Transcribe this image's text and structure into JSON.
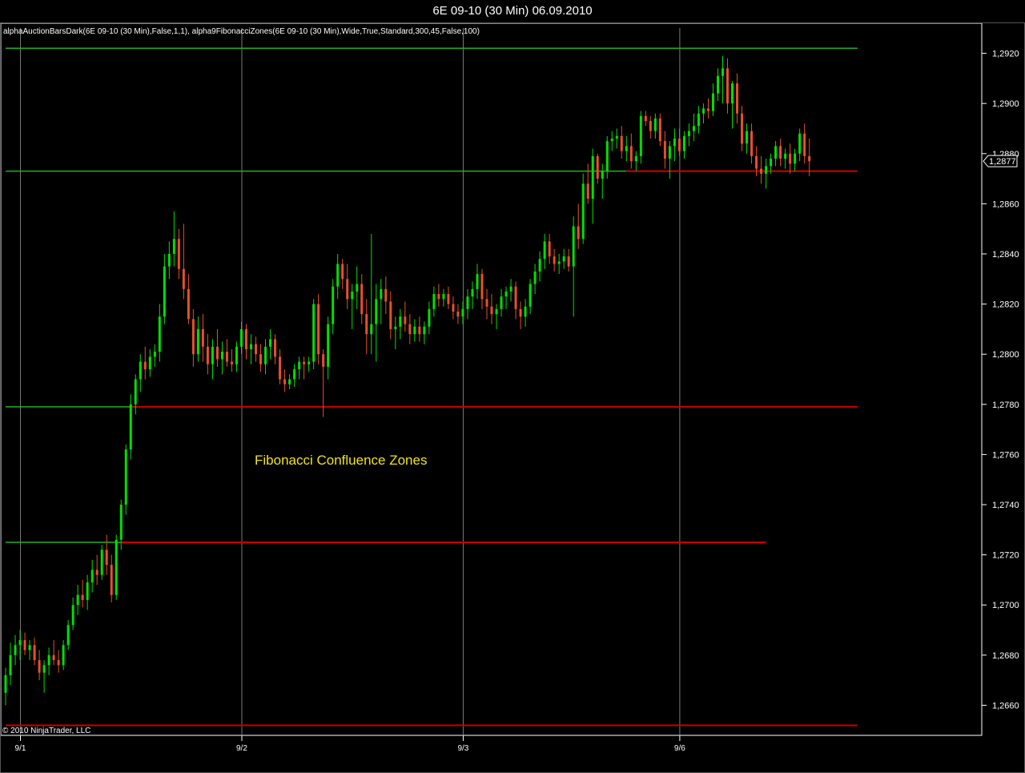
{
  "window": {
    "title": "6E 09-10 (30 Min)  06.09.2010"
  },
  "indicator_text": "alphaAuctionBarsDark(6E 09-10 (30 Min),False,1,1), alpha9FibonacciZones(6E 09-10 (30 Min),Wide,True,Standard,300,45,False,100)",
  "copyright": "© 2010 NinjaTrader, LLC",
  "colors": {
    "background": "#000000",
    "up_bar": "#00e000",
    "down_bar": "#e8502a",
    "zone_green": "#22b022",
    "zone_red": "#cc0000",
    "grid": "#7a7a7a",
    "annotation": "#f2e218"
  },
  "chart_data": {
    "type": "candlestick",
    "instrument": "6E 09-10",
    "timeframe": "30 Min",
    "ylim": [
      1.2648,
      1.2932
    ],
    "y_ticks": [
      "1,2660",
      "1,2680",
      "1,2700",
      "1,2720",
      "1,2740",
      "1,2760",
      "1,2780",
      "1,2800",
      "1,2820",
      "1,2840",
      "1,2860",
      "1,2880",
      "1,2900",
      "1,2920"
    ],
    "y_tick_values": [
      1.266,
      1.268,
      1.27,
      1.272,
      1.274,
      1.276,
      1.278,
      1.28,
      1.282,
      1.284,
      1.286,
      1.288,
      1.29,
      1.292
    ],
    "x_dates": [
      "9/1",
      "9/2",
      "9/3",
      "9/6"
    ],
    "x_date_bar_index": [
      3,
      49,
      95,
      140
    ],
    "last_price": "1,2877",
    "last_price_value": 1.2877,
    "zones": [
      {
        "level": 1.2922,
        "color": "green",
        "start_bar": 0,
        "end_bar": 177
      },
      {
        "level": 1.2873,
        "color": "green",
        "start_bar": 0,
        "end_bar": 129
      },
      {
        "level": 1.2873,
        "color": "red",
        "start_bar": 129,
        "end_bar": 177
      },
      {
        "level": 1.2779,
        "color": "green",
        "start_bar": 0,
        "end_bar": 26
      },
      {
        "level": 1.2779,
        "color": "red",
        "start_bar": 26,
        "end_bar": 177
      },
      {
        "level": 1.2725,
        "color": "green",
        "start_bar": 0,
        "end_bar": 24
      },
      {
        "level": 1.2725,
        "color": "red",
        "start_bar": 24,
        "end_bar": 158
      },
      {
        "level": 1.2652,
        "color": "red",
        "start_bar": 0,
        "end_bar": 177
      }
    ],
    "annotation": "Fibonacci Confluence Zones",
    "bars": [
      [
        1.2665,
        1.2675,
        1.266,
        1.2672
      ],
      [
        1.2672,
        1.2685,
        1.2668,
        1.268
      ],
      [
        1.268,
        1.2688,
        1.2676,
        1.2684
      ],
      [
        1.2684,
        1.269,
        1.2678,
        1.2686
      ],
      [
        1.2686,
        1.2689,
        1.268,
        1.2682
      ],
      [
        1.2682,
        1.2686,
        1.2678,
        1.2684
      ],
      [
        1.2684,
        1.2687,
        1.2676,
        1.2678
      ],
      [
        1.2678,
        1.2682,
        1.267,
        1.2673
      ],
      [
        1.2673,
        1.2678,
        1.2665,
        1.2676
      ],
      [
        1.2676,
        1.2683,
        1.2672,
        1.268
      ],
      [
        1.268,
        1.2686,
        1.2676,
        1.2678
      ],
      [
        1.2678,
        1.2682,
        1.2673,
        1.2676
      ],
      [
        1.2676,
        1.2686,
        1.2674,
        1.2684
      ],
      [
        1.2684,
        1.2694,
        1.2682,
        1.2692
      ],
      [
        1.2692,
        1.2703,
        1.269,
        1.27
      ],
      [
        1.27,
        1.2708,
        1.2696,
        1.2704
      ],
      [
        1.2704,
        1.271,
        1.2699,
        1.2702
      ],
      [
        1.2702,
        1.2712,
        1.2698,
        1.2709
      ],
      [
        1.2709,
        1.2718,
        1.2705,
        1.2714
      ],
      [
        1.2714,
        1.272,
        1.2708,
        1.2712
      ],
      [
        1.2712,
        1.2724,
        1.271,
        1.2722
      ],
      [
        1.2722,
        1.2728,
        1.2712,
        1.2716
      ],
      [
        1.2716,
        1.272,
        1.2701,
        1.2704
      ],
      [
        1.2704,
        1.2728,
        1.2702,
        1.2726
      ],
      [
        1.2726,
        1.2742,
        1.2722,
        1.274
      ],
      [
        1.274,
        1.2764,
        1.2736,
        1.2762
      ],
      [
        1.2762,
        1.2784,
        1.2758,
        1.278
      ],
      [
        1.278,
        1.2792,
        1.2776,
        1.279
      ],
      [
        1.279,
        1.28,
        1.2785,
        1.2797
      ],
      [
        1.2797,
        1.2803,
        1.279,
        1.2794
      ],
      [
        1.2794,
        1.2802,
        1.2791,
        1.2799
      ],
      [
        1.2799,
        1.2804,
        1.2795,
        1.2801
      ],
      [
        1.2801,
        1.282,
        1.2797,
        1.2815
      ],
      [
        1.2815,
        1.284,
        1.2812,
        1.2835
      ],
      [
        1.2835,
        1.2845,
        1.283,
        1.284
      ],
      [
        1.284,
        1.2857,
        1.2835,
        1.2846
      ],
      [
        1.2846,
        1.285,
        1.283,
        1.2834
      ],
      [
        1.2834,
        1.2852,
        1.2822,
        1.2826
      ],
      [
        1.2826,
        1.2832,
        1.2812,
        1.2814
      ],
      [
        1.2814,
        1.2818,
        1.2795,
        1.28
      ],
      [
        1.28,
        1.2815,
        1.2797,
        1.281
      ],
      [
        1.281,
        1.2816,
        1.2797,
        1.2803
      ],
      [
        1.2803,
        1.2808,
        1.2792,
        1.2796
      ],
      [
        1.2796,
        1.2806,
        1.279,
        1.2803
      ],
      [
        1.2803,
        1.281,
        1.2795,
        1.2798
      ],
      [
        1.2798,
        1.2805,
        1.2792,
        1.2801
      ],
      [
        1.2801,
        1.2806,
        1.2795,
        1.2797
      ],
      [
        1.2797,
        1.2802,
        1.2793,
        1.2796
      ],
      [
        1.2796,
        1.2805,
        1.2793,
        1.2803
      ],
      [
        1.2803,
        1.2813,
        1.28,
        1.281
      ],
      [
        1.281,
        1.2812,
        1.2798,
        1.2802
      ],
      [
        1.2802,
        1.2808,
        1.2796,
        1.2804
      ],
      [
        1.2804,
        1.2807,
        1.2797,
        1.28
      ],
      [
        1.28,
        1.2804,
        1.2793,
        1.2796
      ],
      [
        1.2796,
        1.2806,
        1.2792,
        1.2803
      ],
      [
        1.2803,
        1.281,
        1.2798,
        1.2806
      ],
      [
        1.2806,
        1.2808,
        1.2796,
        1.2799
      ],
      [
        1.2799,
        1.2802,
        1.2788,
        1.279
      ],
      [
        1.279,
        1.2794,
        1.2785,
        1.2788
      ],
      [
        1.2788,
        1.2792,
        1.2786,
        1.279
      ],
      [
        1.279,
        1.2796,
        1.2787,
        1.2794
      ],
      [
        1.2794,
        1.2799,
        1.279,
        1.2797
      ],
      [
        1.2797,
        1.2799,
        1.279,
        1.2796
      ],
      [
        1.2796,
        1.2799,
        1.2793,
        1.2797
      ],
      [
        1.2797,
        1.2822,
        1.2794,
        1.282
      ],
      [
        1.282,
        1.2824,
        1.2796,
        1.28
      ],
      [
        1.28,
        1.2802,
        1.2775,
        1.2795
      ],
      [
        1.2795,
        1.2815,
        1.279,
        1.2812
      ],
      [
        1.2812,
        1.283,
        1.2808,
        1.2827
      ],
      [
        1.2827,
        1.284,
        1.2822,
        1.2836
      ],
      [
        1.2836,
        1.2838,
        1.2826,
        1.283
      ],
      [
        1.283,
        1.2836,
        1.2818,
        1.2822
      ],
      [
        1.2822,
        1.2828,
        1.281,
        1.2825
      ],
      [
        1.2825,
        1.2835,
        1.2818,
        1.2828
      ],
      [
        1.2828,
        1.2832,
        1.2812,
        1.2816
      ],
      [
        1.2816,
        1.2822,
        1.28,
        1.2808
      ],
      [
        1.2808,
        1.2848,
        1.28,
        1.2812
      ],
      [
        1.2812,
        1.2828,
        1.2797,
        1.2822
      ],
      [
        1.2822,
        1.283,
        1.2812,
        1.2826
      ],
      [
        1.2826,
        1.2831,
        1.2816,
        1.2821
      ],
      [
        1.2821,
        1.2825,
        1.2806,
        1.281
      ],
      [
        1.281,
        1.2815,
        1.2802,
        1.2811
      ],
      [
        1.2811,
        1.2818,
        1.2806,
        1.2815
      ],
      [
        1.2815,
        1.2821,
        1.2809,
        1.2812
      ],
      [
        1.2812,
        1.2816,
        1.2804,
        1.2808
      ],
      [
        1.2808,
        1.2814,
        1.2805,
        1.2811
      ],
      [
        1.2811,
        1.2815,
        1.2805,
        1.2808
      ],
      [
        1.2808,
        1.2813,
        1.2804,
        1.2811
      ],
      [
        1.2811,
        1.2821,
        1.2808,
        1.2818
      ],
      [
        1.2818,
        1.2827,
        1.2815,
        1.2824
      ],
      [
        1.2824,
        1.2828,
        1.2819,
        1.2822
      ],
      [
        1.2822,
        1.2826,
        1.2819,
        1.2824
      ],
      [
        1.2824,
        1.2827,
        1.2818,
        1.282
      ],
      [
        1.282,
        1.2823,
        1.2814,
        1.2817
      ],
      [
        1.2817,
        1.282,
        1.2812,
        1.2815
      ],
      [
        1.2815,
        1.2821,
        1.2812,
        1.2818
      ],
      [
        1.2818,
        1.2826,
        1.2814,
        1.2823
      ],
      [
        1.2823,
        1.2829,
        1.2818,
        1.2826
      ],
      [
        1.2826,
        1.2836,
        1.2822,
        1.2832
      ],
      [
        1.2832,
        1.2834,
        1.2818,
        1.2822
      ],
      [
        1.2822,
        1.2826,
        1.2814,
        1.2819
      ],
      [
        1.2819,
        1.2824,
        1.2812,
        1.2816
      ],
      [
        1.2816,
        1.282,
        1.281,
        1.2818
      ],
      [
        1.2818,
        1.2826,
        1.2815,
        1.2823
      ],
      [
        1.2823,
        1.2827,
        1.2818,
        1.2825
      ],
      [
        1.2825,
        1.283,
        1.2821,
        1.2827
      ],
      [
        1.2827,
        1.2829,
        1.2814,
        1.2818
      ],
      [
        1.2818,
        1.2821,
        1.281,
        1.2815
      ],
      [
        1.2815,
        1.2822,
        1.2811,
        1.2819
      ],
      [
        1.2819,
        1.283,
        1.2816,
        1.2828
      ],
      [
        1.2828,
        1.2836,
        1.2824,
        1.2833
      ],
      [
        1.2833,
        1.2841,
        1.2829,
        1.2838
      ],
      [
        1.2838,
        1.2848,
        1.2834,
        1.2845
      ],
      [
        1.2845,
        1.2848,
        1.2836,
        1.2839
      ],
      [
        1.2839,
        1.2842,
        1.2833,
        1.2836
      ],
      [
        1.2836,
        1.284,
        1.2832,
        1.2837
      ],
      [
        1.2837,
        1.2842,
        1.2834,
        1.2839
      ],
      [
        1.2839,
        1.2842,
        1.2833,
        1.2835
      ],
      [
        1.2835,
        1.2855,
        1.2815,
        1.2851
      ],
      [
        1.2851,
        1.286,
        1.2842,
        1.2846
      ],
      [
        1.2846,
        1.2872,
        1.2844,
        1.2868
      ],
      [
        1.2868,
        1.2876,
        1.286,
        1.2862
      ],
      [
        1.2862,
        1.2882,
        1.2852,
        1.2879
      ],
      [
        1.2879,
        1.288,
        1.2868,
        1.287
      ],
      [
        1.287,
        1.2876,
        1.2862,
        1.2873
      ],
      [
        1.2873,
        1.2887,
        1.287,
        1.2885
      ],
      [
        1.2885,
        1.2889,
        1.2881,
        1.2886
      ],
      [
        1.2886,
        1.289,
        1.2882,
        1.2887
      ],
      [
        1.2887,
        1.2891,
        1.2878,
        1.2881
      ],
      [
        1.2881,
        1.2887,
        1.2877,
        1.2883
      ],
      [
        1.2883,
        1.2888,
        1.2874,
        1.2877
      ],
      [
        1.2877,
        1.2881,
        1.2873,
        1.2879
      ],
      [
        1.2879,
        1.2897,
        1.2876,
        1.2895
      ],
      [
        1.2895,
        1.2897,
        1.2891,
        1.2893
      ],
      [
        1.2893,
        1.2895,
        1.2886,
        1.2889
      ],
      [
        1.2889,
        1.2896,
        1.2886,
        1.2894
      ],
      [
        1.2894,
        1.2896,
        1.2883,
        1.2885
      ],
      [
        1.2885,
        1.2889,
        1.2874,
        1.2878
      ],
      [
        1.2878,
        1.2885,
        1.287,
        1.2883
      ],
      [
        1.2883,
        1.289,
        1.2877,
        1.2886
      ],
      [
        1.2886,
        1.289,
        1.2879,
        1.2881
      ],
      [
        1.2881,
        1.2889,
        1.2878,
        1.2887
      ],
      [
        1.2887,
        1.2892,
        1.2883,
        1.2889
      ],
      [
        1.2889,
        1.2896,
        1.2885,
        1.2891
      ],
      [
        1.2891,
        1.2899,
        1.2888,
        1.2896
      ],
      [
        1.2896,
        1.29,
        1.2892,
        1.2898
      ],
      [
        1.2898,
        1.2902,
        1.2894,
        1.2897
      ],
      [
        1.2897,
        1.2908,
        1.2895,
        1.2904
      ],
      [
        1.2904,
        1.2914,
        1.2901,
        1.2911
      ],
      [
        1.2911,
        1.2919,
        1.29,
        1.2914
      ],
      [
        1.2914,
        1.2918,
        1.2896,
        1.29
      ],
      [
        1.29,
        1.2909,
        1.289,
        1.2908
      ],
      [
        1.2908,
        1.2912,
        1.2892,
        1.2896
      ],
      [
        1.2896,
        1.2899,
        1.2881,
        1.2884
      ],
      [
        1.2884,
        1.2892,
        1.288,
        1.2889
      ],
      [
        1.2889,
        1.2892,
        1.2876,
        1.2879
      ],
      [
        1.2879,
        1.2883,
        1.2871,
        1.2874
      ],
      [
        1.2874,
        1.2879,
        1.2868,
        1.2872
      ],
      [
        1.2872,
        1.2878,
        1.2866,
        1.2875
      ],
      [
        1.2875,
        1.288,
        1.2872,
        1.2878
      ],
      [
        1.2878,
        1.2885,
        1.2875,
        1.2883
      ],
      [
        1.2883,
        1.2886,
        1.2875,
        1.2878
      ],
      [
        1.2878,
        1.2882,
        1.2874,
        1.288
      ],
      [
        1.288,
        1.2884,
        1.2872,
        1.2876
      ],
      [
        1.2876,
        1.2882,
        1.2873,
        1.288
      ],
      [
        1.288,
        1.289,
        1.2877,
        1.2888
      ],
      [
        1.2888,
        1.2892,
        1.2876,
        1.2879
      ],
      [
        1.2879,
        1.2886,
        1.2871,
        1.2877
      ]
    ]
  }
}
